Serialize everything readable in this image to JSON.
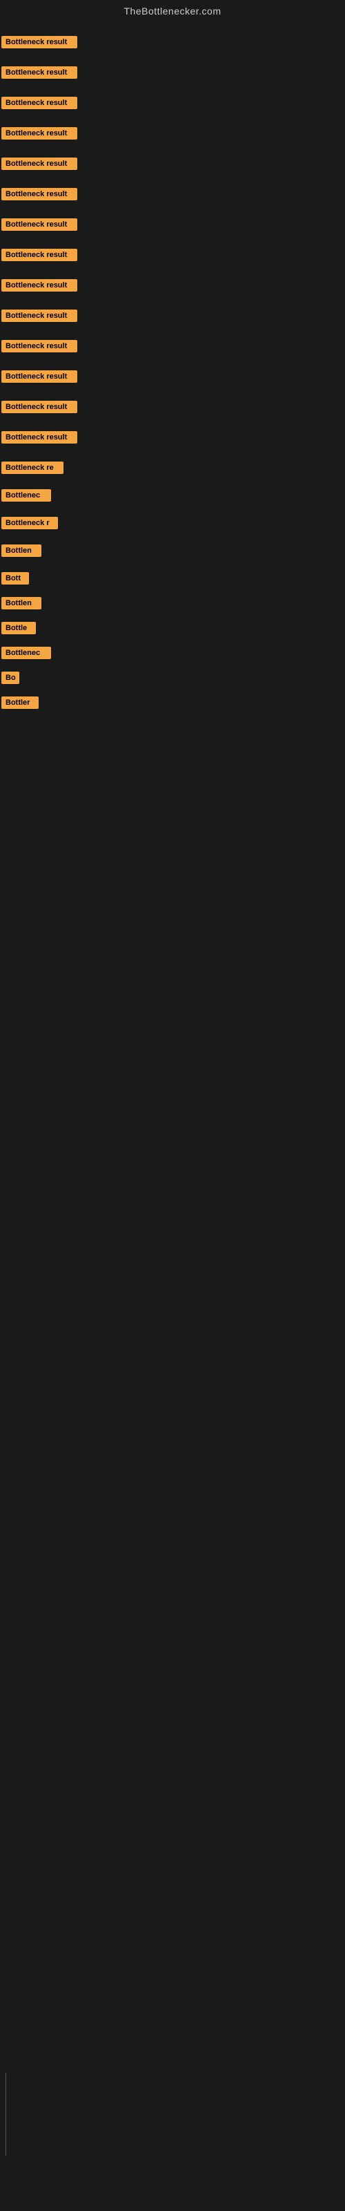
{
  "site": {
    "title": "TheBottlenecker.com"
  },
  "items": [
    {
      "id": 1,
      "label": "Bottleneck result",
      "badge_width": 110
    },
    {
      "id": 2,
      "label": "Bottleneck result",
      "badge_width": 110
    },
    {
      "id": 3,
      "label": "Bottleneck result",
      "badge_width": 110
    },
    {
      "id": 4,
      "label": "Bottleneck result",
      "badge_width": 110
    },
    {
      "id": 5,
      "label": "Bottleneck result",
      "badge_width": 110
    },
    {
      "id": 6,
      "label": "Bottleneck result",
      "badge_width": 110
    },
    {
      "id": 7,
      "label": "Bottleneck result",
      "badge_width": 110
    },
    {
      "id": 8,
      "label": "Bottleneck result",
      "badge_width": 110
    },
    {
      "id": 9,
      "label": "Bottleneck result",
      "badge_width": 110
    },
    {
      "id": 10,
      "label": "Bottleneck result",
      "badge_width": 110
    },
    {
      "id": 11,
      "label": "Bottleneck result",
      "badge_width": 110
    },
    {
      "id": 12,
      "label": "Bottleneck result",
      "badge_width": 110
    },
    {
      "id": 13,
      "label": "Bottleneck result",
      "badge_width": 110
    },
    {
      "id": 14,
      "label": "Bottleneck result",
      "badge_width": 110
    },
    {
      "id": 15,
      "label": "Bottleneck re",
      "badge_width": 90
    },
    {
      "id": 16,
      "label": "Bottlenec",
      "badge_width": 72
    },
    {
      "id": 17,
      "label": "Bottleneck r",
      "badge_width": 82
    },
    {
      "id": 18,
      "label": "Bottlen",
      "badge_width": 58
    },
    {
      "id": 19,
      "label": "Bott",
      "badge_width": 40
    },
    {
      "id": 20,
      "label": "Bottlen",
      "badge_width": 58
    },
    {
      "id": 21,
      "label": "Bottle",
      "badge_width": 50
    },
    {
      "id": 22,
      "label": "Bottlenec",
      "badge_width": 72
    },
    {
      "id": 23,
      "label": "Bo",
      "badge_width": 26
    },
    {
      "id": 24,
      "label": "Bottler",
      "badge_width": 54
    }
  ],
  "colors": {
    "badge_bg": "#f5a642",
    "badge_text": "#000000",
    "site_title": "#cccccc",
    "body_bg": "#1a1a1a"
  }
}
